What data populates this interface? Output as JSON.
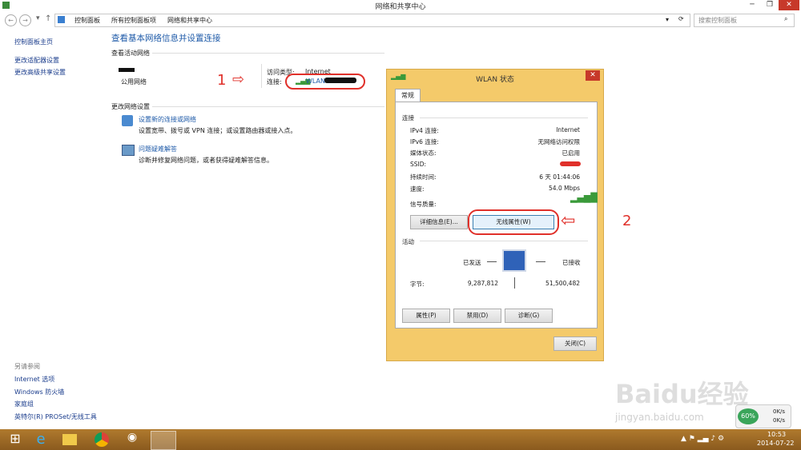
{
  "window": {
    "title": "网络和共享中心",
    "min": "─",
    "restore": "❐",
    "close": "✕"
  },
  "address": {
    "breadcrumbs": [
      "控制面板",
      "所有控制面板项",
      "网络和共享中心"
    ],
    "search_placeholder": "搜索控制面板"
  },
  "left_pane": {
    "items": [
      "控制面板主页",
      "更改适配器设置",
      "更改高级共享设置"
    ],
    "see_also_title": "另请参阅",
    "see_also": [
      "Internet 选项",
      "Windows 防火墙",
      "家庭组",
      "英特尔(R) PROSet/无线工具"
    ]
  },
  "main": {
    "title": "查看基本网络信息并设置连接",
    "active_section": "查看活动网络",
    "network_type": "公用网络",
    "access_type_label": "访问类型:",
    "access_type_value": "Internet",
    "connection_label": "连接:",
    "connection_value": "WLAN",
    "change_section": "更改网络设置",
    "tasks": [
      {
        "link": "设置新的连接或网络",
        "desc": "设置宽带、拨号或 VPN 连接；或设置路由器或接入点。"
      },
      {
        "link": "问题疑难解答",
        "desc": "诊断并修复网络问题，或者获得疑难解答信息。"
      }
    ]
  },
  "dialog": {
    "title": "WLAN 状态",
    "tab": "常规",
    "connection_title": "连接",
    "rows": [
      {
        "label": "IPv4 连接:",
        "value": "Internet"
      },
      {
        "label": "IPv6 连接:",
        "value": "无网络访问权限"
      },
      {
        "label": "媒体状态:",
        "value": "已启用"
      },
      {
        "label": "SSID:",
        "value": ""
      },
      {
        "label": "持续时间:",
        "value": "6 天 01:44:06"
      },
      {
        "label": "速度:",
        "value": "54.0 Mbps"
      },
      {
        "label": "信号质量:",
        "value": ""
      }
    ],
    "details_btn": "详细信息(E)...",
    "wireless_btn": "无线属性(W)",
    "activity_title": "活动",
    "sent": "已发送",
    "received": "已接收",
    "bytes_label": "字节:",
    "sent_bytes": "9,287,812",
    "received_bytes": "51,500,482",
    "properties_btn": "属性(P)",
    "disable_btn": "禁用(D)",
    "diagnose_btn": "诊断(G)",
    "close_btn": "关闭(C)"
  },
  "annotations": {
    "one": "1",
    "two": "2"
  },
  "widget": {
    "percent": "60%",
    "up": "0K/s",
    "down": "0K/s"
  },
  "watermark": "Baidu经验",
  "watermark_url": "jingyan.baidu.com",
  "clock": {
    "time": "10:53",
    "date": "2014-07-22"
  },
  "colors": {
    "accent": "#1e5aa8",
    "dialog": "#f4ca6a",
    "taskbar": "#9a6a26",
    "annotation": "#e0302a"
  }
}
